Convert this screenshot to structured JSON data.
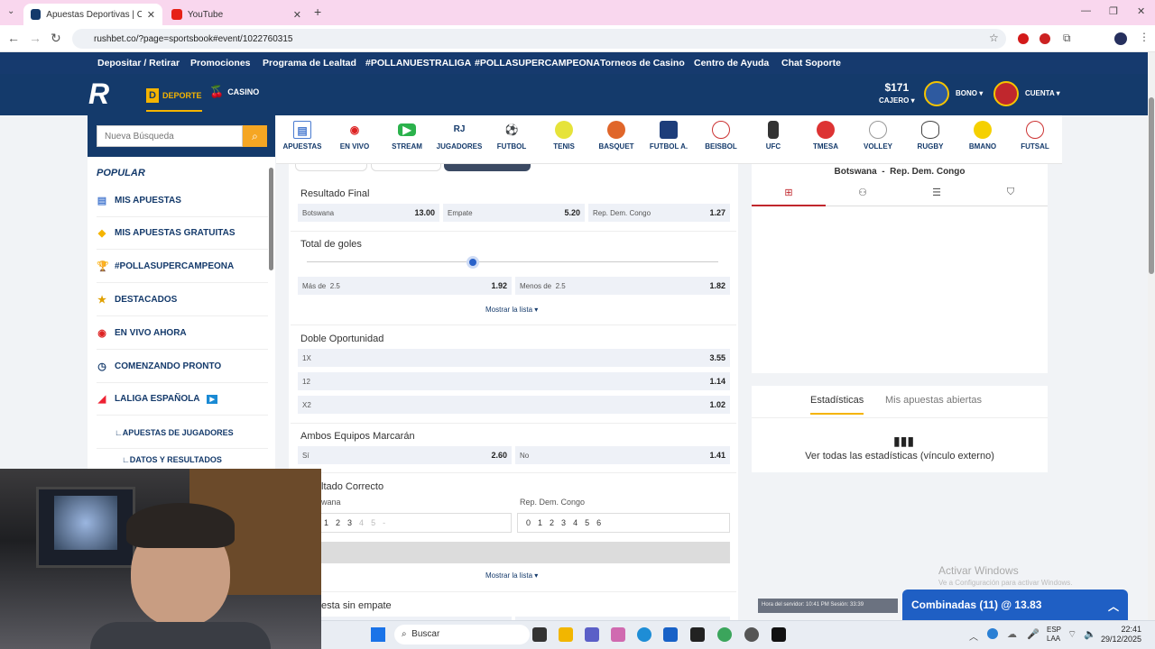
{
  "browser": {
    "tabs": [
      {
        "label": "Apuestas Deportivas | Casa de A"
      },
      {
        "label": "YouTube"
      }
    ],
    "url": "rushbet.co/?page=sportsbook#event/1022760315"
  },
  "site_nav": [
    "Depositar / Retirar",
    "Promociones",
    "Programa de Lealtad",
    "#POLLANUESTRALIGA",
    "#POLLASUPERCAMPEONA",
    "Torneos de Casino",
    "Centro de Ayuda",
    "Chat Soporte"
  ],
  "header": {
    "deporte": "DEPORTE",
    "casino": "CASINO",
    "balance": "$171",
    "cajero": "CAJERO",
    "bono": "BONO",
    "cuenta": "CUENTA"
  },
  "search": {
    "placeholder": "Nueva Búsqueda"
  },
  "sidebar": {
    "heading": "POPULAR",
    "items": [
      {
        "label": "MIS APUESTAS"
      },
      {
        "label": "MIS APUESTAS GRATUITAS"
      },
      {
        "label": "#POLLASUPERCAMPEONA"
      },
      {
        "label": "DESTACADOS"
      },
      {
        "label": "EN VIVO AHORA"
      },
      {
        "label": "COMENZANDO PRONTO"
      },
      {
        "label": "LALIGA ESPAÑOLA"
      },
      {
        "label": "∟APUESTAS DE JUGADORES"
      },
      {
        "label": "∟DATOS Y RESULTADOS"
      }
    ]
  },
  "sports": [
    "APUESTAS",
    "EN VIVO",
    "STREAM",
    "JUGADORES",
    "FUTBOL",
    "TENIS",
    "BASQUET",
    "FUTBOL A.",
    "BEISBOL",
    "UFC",
    "TMESA",
    "VOLLEY",
    "RUGBY",
    "BMANO",
    "FUTSAL"
  ],
  "markets": {
    "resultado_final": {
      "title": "Resultado Final",
      "odds": [
        {
          "label": "Botswana",
          "value": "13.00"
        },
        {
          "label": "Empate",
          "value": "5.20"
        },
        {
          "label": "Rep. Dem. Congo",
          "value": "1.27"
        }
      ]
    },
    "total_goles": {
      "title": "Total de goles",
      "odds": [
        {
          "label": "Más de",
          "line": "2.5",
          "value": "1.92"
        },
        {
          "label": "Menos de",
          "line": "2.5",
          "value": "1.82"
        }
      ],
      "more": "Mostrar la lista"
    },
    "doble_oportunidad": {
      "title": "Doble Oportunidad",
      "odds": [
        {
          "label": "1X",
          "value": "3.55"
        },
        {
          "label": "12",
          "value": "1.14"
        },
        {
          "label": "X2",
          "value": "1.02"
        }
      ]
    },
    "ambos_marcan": {
      "title": "Ambos Equipos Marcarán",
      "odds": [
        {
          "label": "Sí",
          "value": "2.60"
        },
        {
          "label": "No",
          "value": "1.41"
        }
      ]
    },
    "resultado_correcto": {
      "title": "ltado Correcto",
      "team_home": "wana",
      "team_away": "Rep. Dem. Congo",
      "home_scores": [
        "1",
        "2",
        "3",
        "4",
        "5",
        "-"
      ],
      "away_scores": [
        "0",
        "1",
        "2",
        "3",
        "4",
        "5",
        "6"
      ],
      "more": "Mostrar la lista"
    },
    "next_title": "esta sin empate"
  },
  "match": {
    "home": "Botswana",
    "away": "Rep. Dem. Congo"
  },
  "stats": {
    "tab_stats": "Estadísticas",
    "tab_open": "Mis apuestas abiertas",
    "link": "Ver todas las estadísticas (vínculo externo)"
  },
  "server": {
    "text": "Hora del servidor: 10:41 PM   Sesión: 33:39"
  },
  "combinadas": {
    "label": "Combinadas (11) @ 13.83"
  },
  "watermark": {
    "title": "Activar Windows",
    "sub": "Ve a Configuración para activar Windows."
  },
  "taskbar": {
    "search": "Buscar",
    "lang1": "ESP",
    "lang2": "LAA",
    "time": "22:41",
    "date": "29/12/2025"
  }
}
